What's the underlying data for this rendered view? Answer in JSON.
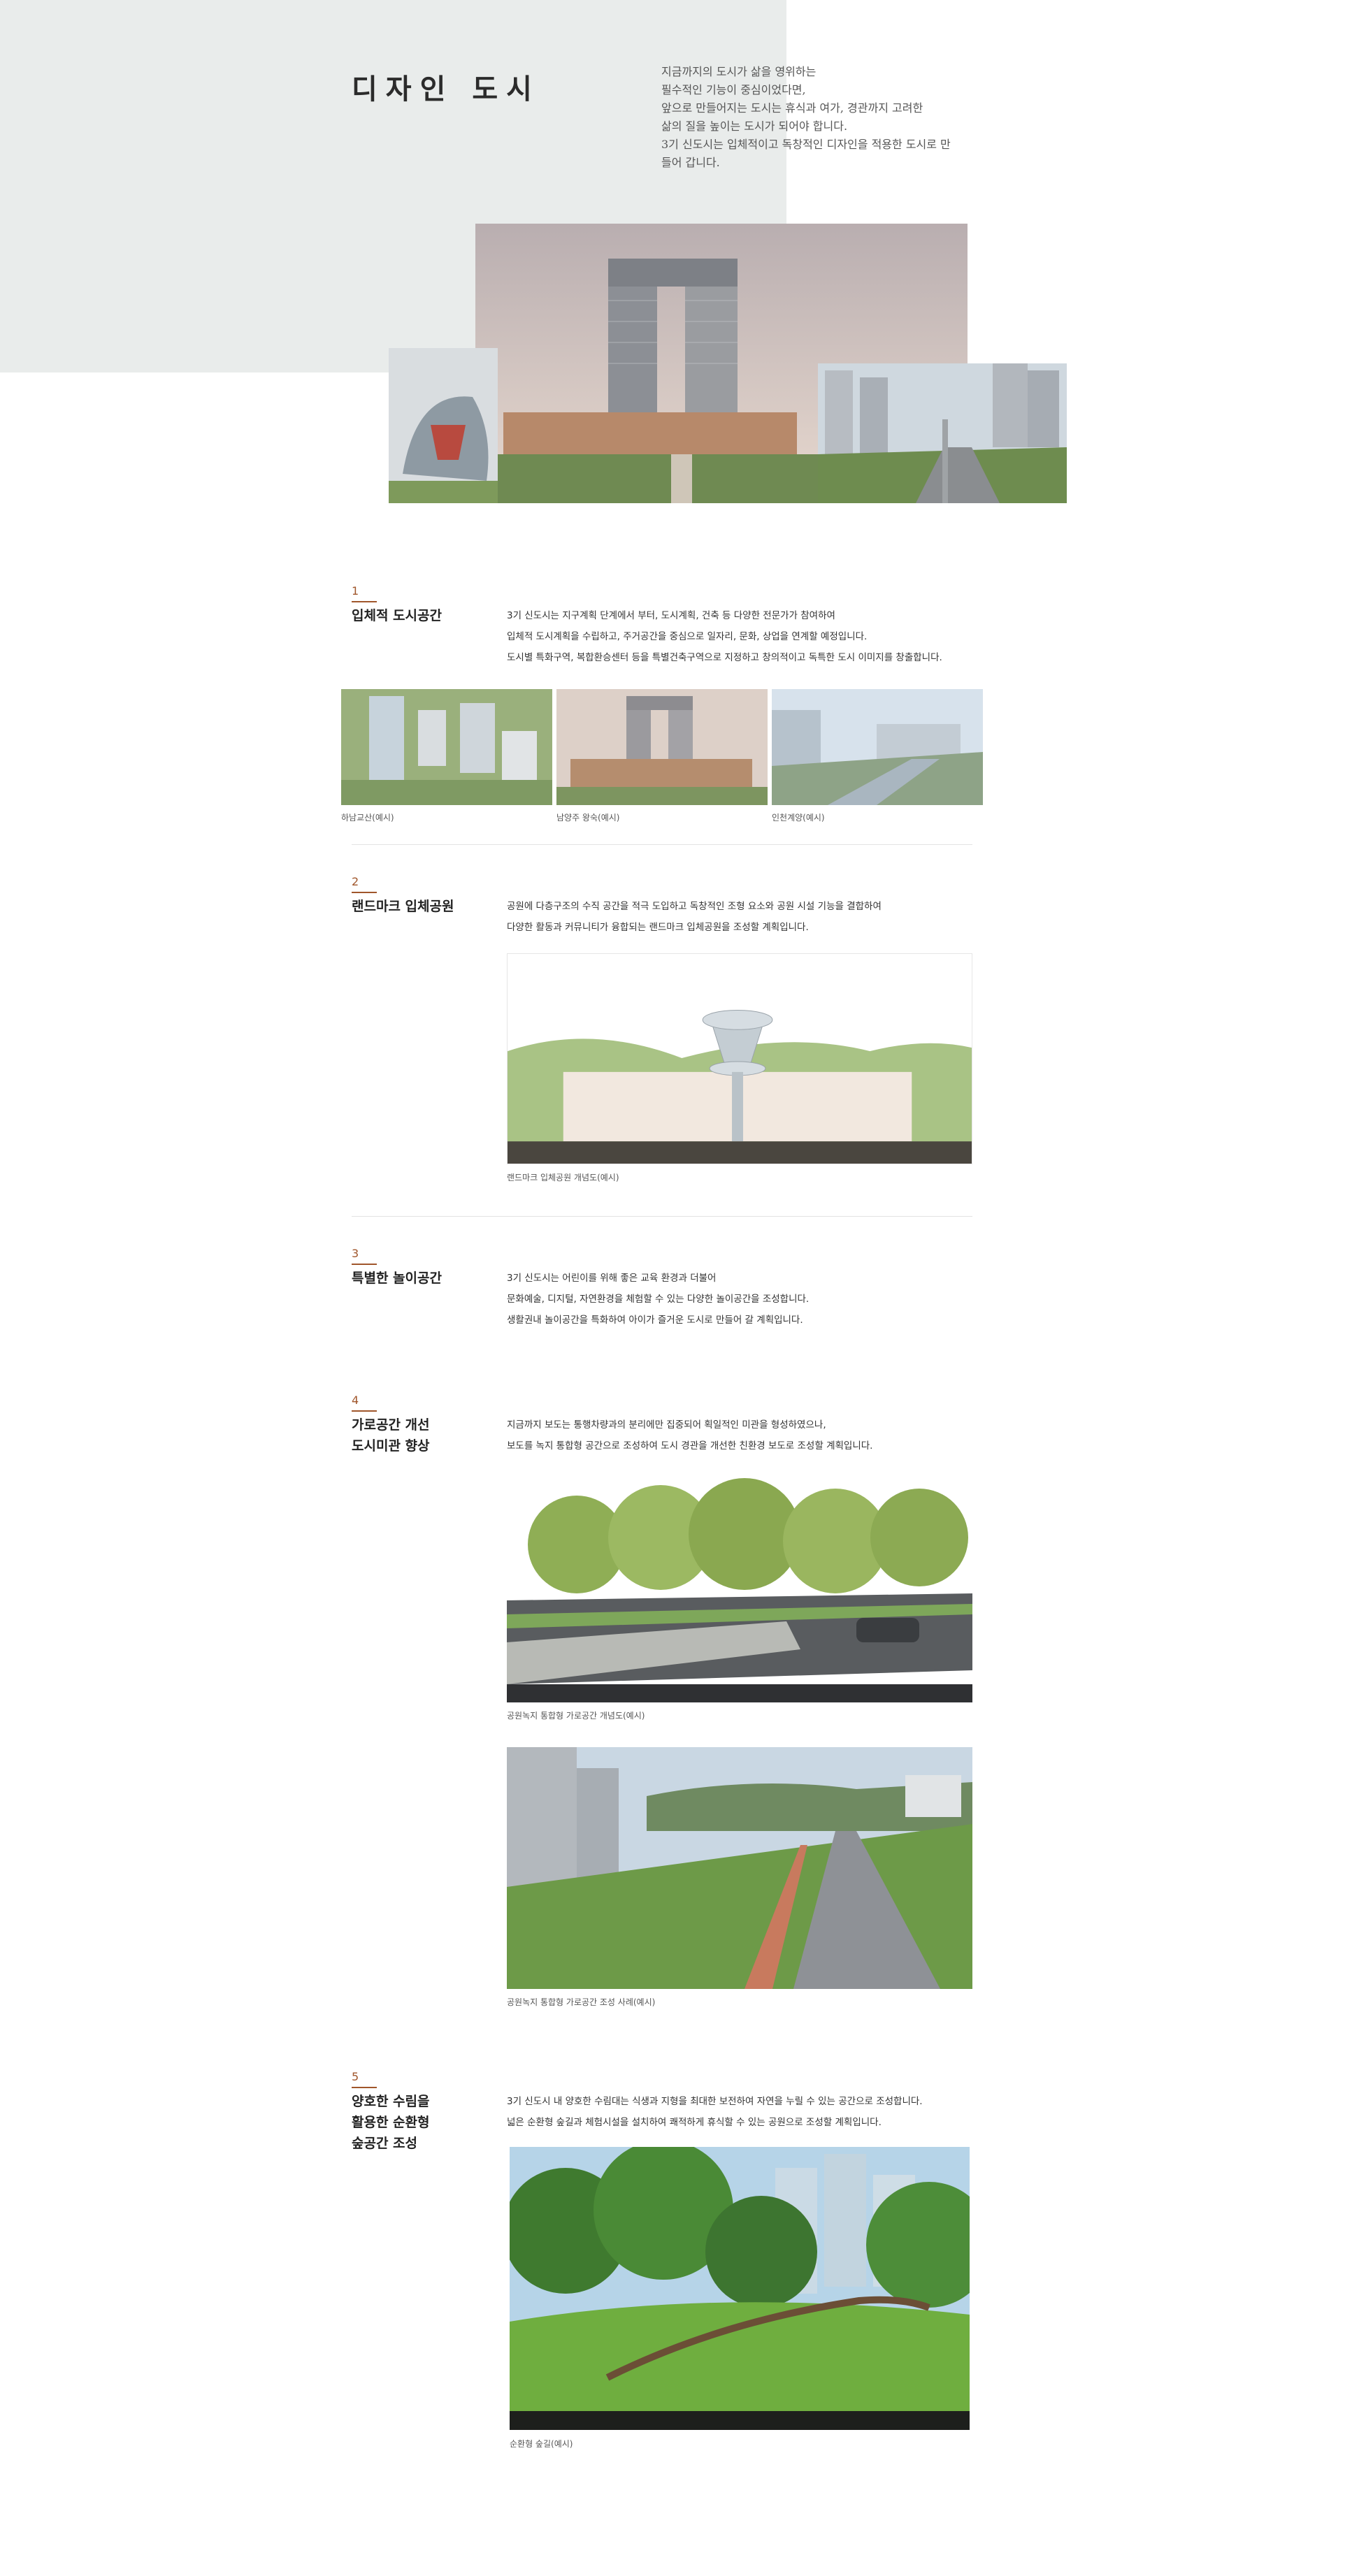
{
  "hero": {
    "title": "디자인 도시",
    "intro_lines": [
      "지금까지의 도시가 삶을 영위하는",
      "필수적인 기능이 중심이었다면,",
      "앞으로 만들어지는 도시는 휴식과 여가, 경관까지 고려한",
      "삶의 질을 높이는 도시가 되어야 합니다.",
      "3기 신도시는 입체적이고 독창적인 디자인을 적용한 도시로 만",
      "들어 갑니다."
    ]
  },
  "sections": [
    {
      "number": "1",
      "title_lines": [
        "입체적 도시공간"
      ],
      "desc_lines": [
        "3기 신도시는 지구계획 단계에서 부터, 도시계획, 건축 등 다양한 전문가가 참여하여",
        "입체적 도시계획을 수립하고, 주거공간을 중심으로 일자리, 문화, 상업을 연계할 예정입니다.",
        "도시별 특화구역, 복합환승센터 등을 특별건축구역으로 지정하고 창의적이고 독특한 도시 이미지를 창출합니다."
      ],
      "captions": [
        "하남교산(예시)",
        "남양주 왕숙(예시)",
        "인천계양(예시)"
      ]
    },
    {
      "number": "2",
      "title_lines": [
        "랜드마크 입체공원"
      ],
      "desc_lines": [
        "공원에 다층구조의 수직 공간을 적극 도입하고 독창적인 조형 요소와 공원 시설 기능을 결합하여",
        "다양한 활동과 커뮤니티가 융합되는 랜드마크 입체공원을 조성할 계획입니다."
      ],
      "captions": [
        "랜드마크 입체공원 개념도(예시)"
      ]
    },
    {
      "number": "3",
      "title_lines": [
        "특별한 놀이공간"
      ],
      "desc_lines": [
        "3기 신도시는 어린이를 위해 좋은 교육 환경과 더불어",
        "문화예술, 디지털, 자연환경을 체험할 수 있는 다양한 놀이공간을 조성합니다.",
        "생활권내 놀이공간을 특화하여 아이가 즐거운 도시로 만들어 갈 계획입니다."
      ],
      "captions": []
    },
    {
      "number": "4",
      "title_lines": [
        "가로공간 개선",
        "도시미관 향상"
      ],
      "desc_lines": [
        "지금까지 보도는 통행차량과의 분리에만 집중되어 획일적인 미관을 형성하였으나,",
        "보도를 녹지 통합형 공간으로 조성하여 도시 경관을 개선한 친환경 보도로 조성할 계획입니다."
      ],
      "captions": [
        "공원녹지 통합형 가로공간 개념도(예시)",
        "공원녹지 통합형 가로공간 조성 사례(예시)"
      ]
    },
    {
      "number": "5",
      "title_lines": [
        "양호한 수림을",
        "활용한 순환형",
        "숲공간 조성"
      ],
      "desc_lines": [
        "3기 신도시 내 양호한 수림대는 식생과 지형을 최대한 보전하여 자연을 누릴 수 있는 공간으로 조성합니다.",
        "넓은 순환형 숲길과 체험시설을 설치하여 쾌적하게 휴식할 수 있는 공원으로 조성할 계획입니다."
      ],
      "captions": [
        "순환형 숲길(예시)"
      ]
    }
  ]
}
